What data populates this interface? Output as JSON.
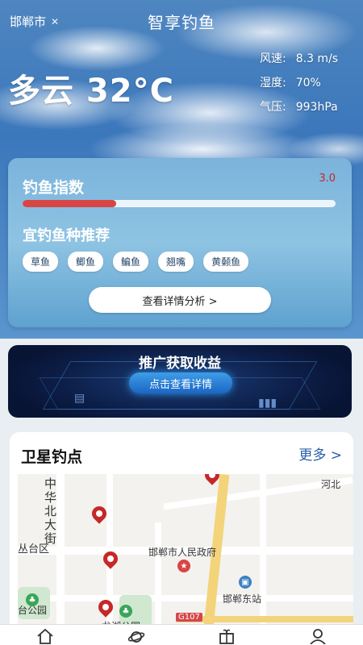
{
  "header": {
    "city": "邯郸市",
    "app_title": "智享钓鱼"
  },
  "weather": {
    "summary": "多云 32°C",
    "stats": [
      {
        "label": "风速:",
        "value": "8.3 m/s"
      },
      {
        "label": "湿度:",
        "value": "70%"
      },
      {
        "label": "气压:",
        "value": "993hPa"
      }
    ]
  },
  "fishing_index": {
    "label": "钓鱼指数",
    "value": "3.0",
    "fill_fraction": 0.3,
    "fill_color": "#d84545",
    "recommend_label": "宜钓鱼种推荐",
    "fish": [
      "草鱼",
      "鲫鱼",
      "鳊鱼",
      "翘嘴",
      "黄颡鱼"
    ],
    "detail_button": "查看详情分析 >"
  },
  "promo": {
    "title": "推广获取收益",
    "button": "点击查看详情"
  },
  "satellite_spots": {
    "title": "卫星钓点",
    "more": "更多 >",
    "map_labels": {
      "street": "中华北大街",
      "district": "丛台区",
      "gov": "邯郸市人民政府",
      "station": "邯郸东站",
      "park": "台公园",
      "lake": "龙湖公园",
      "hebei": "河北",
      "road_badge": "G107"
    }
  },
  "bottom_nav": [
    "home-icon",
    "planet-icon",
    "gift-icon",
    "user-icon"
  ]
}
